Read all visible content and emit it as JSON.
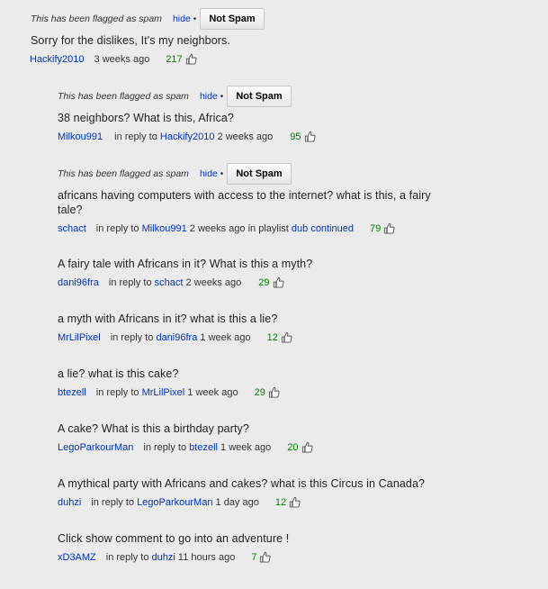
{
  "flag": {
    "text": "This has been flagged as spam",
    "hide": "hide",
    "dot": "•",
    "not_spam": "Not Spam"
  },
  "labels": {
    "in_reply_to": "in reply to",
    "in_playlist": "in playlist"
  },
  "comments": [
    {
      "text": "Sorry for the dislikes, It's my neighbors.",
      "user": "Hackify2010",
      "time": "3 weeks ago",
      "score": "217"
    },
    {
      "text": "38 neighbors? What is this, Africa?",
      "user": "Milkou991",
      "reply_to": "Hackify2010",
      "time": "2 weeks ago",
      "score": "95"
    },
    {
      "text": "africans having computers with access to the internet? what is this, a fairy tale?",
      "user": "schact",
      "reply_to": "Milkou991",
      "time": "2 weeks ago",
      "playlist": "dub continued",
      "score": "79"
    },
    {
      "text": "A fairy tale with Africans in it? What is this a myth?",
      "user": "dani96fra",
      "reply_to": "schact",
      "time": "2 weeks ago",
      "score": "29"
    },
    {
      "text": "a myth with Africans in it? what is this a lie?",
      "user": "MrLilPixel",
      "reply_to": "dani96fra",
      "time": "1 week ago",
      "score": "12"
    },
    {
      "text": "a lie? what is this cake?",
      "user": "btezell",
      "reply_to": "MrLilPixel",
      "time": "1 week ago",
      "score": "29"
    },
    {
      "text": "A cake? What is this a birthday party?",
      "user": "LegoParkourMan",
      "reply_to": "btezell",
      "time": "1 week ago",
      "score": "20"
    },
    {
      "text": "A mythical party with Africans and cakes? what is this Circus in Canada?",
      "user": "duhzi",
      "reply_to": "LegoParkourMan",
      "time": "1 day ago",
      "score": "12"
    },
    {
      "text": "Click show comment to go into an adventure !",
      "user": "xD3AMZ",
      "reply_to": "duhzi",
      "time": "11 hours ago",
      "score": "7"
    }
  ]
}
